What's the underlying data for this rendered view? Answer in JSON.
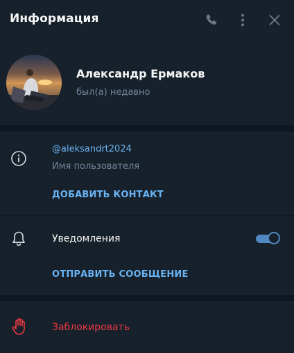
{
  "header": {
    "title": "Информация",
    "icons": {
      "call": "phone-icon",
      "more": "more-vertical-icon",
      "close": "close-icon"
    }
  },
  "profile": {
    "name": "Александр Ермаков",
    "status": "был(а) недавно"
  },
  "info": {
    "username": "@aleksandrt2024",
    "username_label": "Имя пользователя",
    "add_contact": "ДОБАВИТЬ КОНТАКТ"
  },
  "notifications": {
    "label": "Уведомления",
    "enabled": true,
    "send_message": "ОТПРАВИТЬ СООБЩЕНИЕ"
  },
  "block": {
    "label": "Заблокировать"
  },
  "colors": {
    "background": "#17212b",
    "separator": "#0e1621",
    "accent": "#6ab3f3",
    "toggle": "#5288c1",
    "secondary_text": "#708499",
    "danger": "#ec3942"
  }
}
